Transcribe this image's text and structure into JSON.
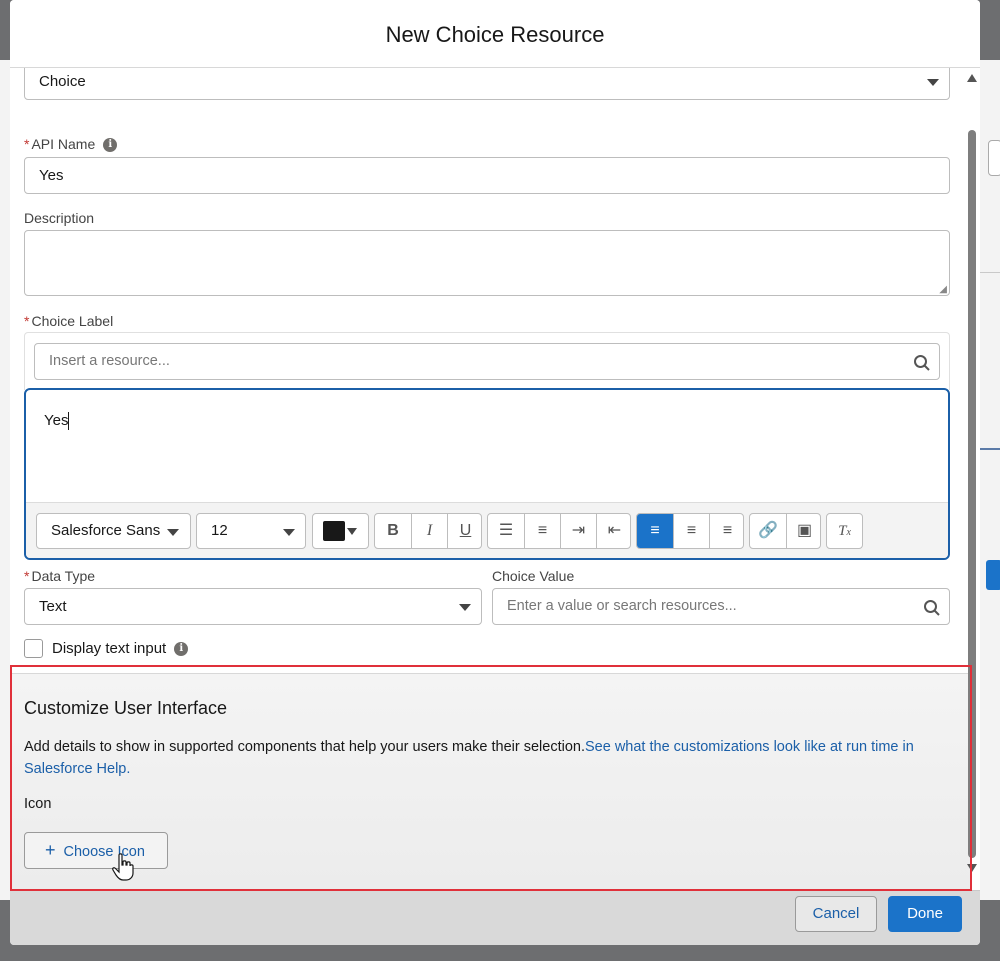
{
  "modal": {
    "title": "New Choice Resource"
  },
  "resource_type": {
    "value": "Choice"
  },
  "api_name": {
    "label": "API Name",
    "value": "Yes"
  },
  "description": {
    "label": "Description",
    "value": ""
  },
  "choice_label": {
    "label": "Choice Label",
    "resource_placeholder": "Insert a resource...",
    "content": "Yes",
    "toolbar": {
      "font": "Salesforce Sans",
      "size": "12",
      "bold": "B",
      "italic": "I",
      "underline": "U"
    }
  },
  "data_type": {
    "label": "Data Type",
    "value": "Text"
  },
  "choice_value": {
    "label": "Choice Value",
    "placeholder": "Enter a value or search resources..."
  },
  "display_text_input": {
    "label": "Display text input",
    "checked": false
  },
  "customize_ui": {
    "title": "Customize User Interface",
    "description": "Add details to show in supported components that help your users make their selection.",
    "link": "See what the customizations look like at run time in Salesforce Help.",
    "icon_label": "Icon",
    "choose_icon_button": "Choose Icon"
  },
  "footer": {
    "cancel": "Cancel",
    "done": "Done"
  },
  "colors": {
    "brand_blue": "#1b73c9",
    "highlight_red": "#e0303a",
    "required": "#c23934"
  }
}
